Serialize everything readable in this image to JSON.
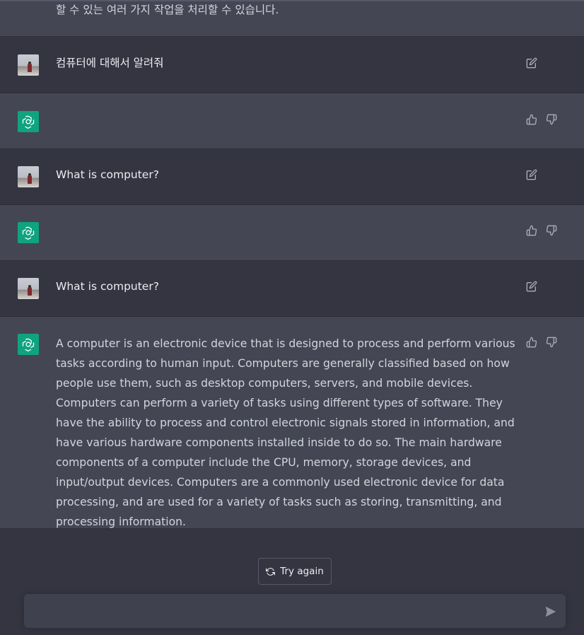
{
  "previous_message_tail": "할 수 있는 여러 가지 작업을 처리할 수 있습니다.",
  "messages": [
    {
      "role": "user",
      "text": "컴퓨터에 대해서 알려줘"
    },
    {
      "role": "assistant",
      "text": ""
    },
    {
      "role": "user",
      "text": "What is computer?"
    },
    {
      "role": "assistant",
      "text": ""
    },
    {
      "role": "user",
      "text": "What is computer?"
    },
    {
      "role": "assistant",
      "text": "A computer is an electronic device that is designed to process and perform various tasks according to human input. Computers are generally classified based on how people use them, such as desktop computers, servers, and mobile devices. Computers can perform a variety of tasks using different types of software. They have the ability to process and control electronic signals stored in information, and have various hardware components installed inside to do so. The main hardware components of a computer include the CPU, memory, storage devices, and input/output devices. Computers are a commonly used electronic device for data processing, and are used for a variety of tasks such as storing, transmitting, and processing information."
    }
  ],
  "controls": {
    "try_again_label": "Try again",
    "input_placeholder": "",
    "input_value": ""
  },
  "icons": {
    "edit": "edit-icon",
    "thumbs_up": "thumbs-up-icon",
    "thumbs_down": "thumbs-down-icon",
    "refresh": "refresh-icon",
    "send": "send-icon",
    "assistant_logo": "openai-logo-icon"
  },
  "colors": {
    "background": "#343541",
    "assistant_row": "#444654",
    "brand": "#10a37f",
    "text": "#ececf1"
  }
}
